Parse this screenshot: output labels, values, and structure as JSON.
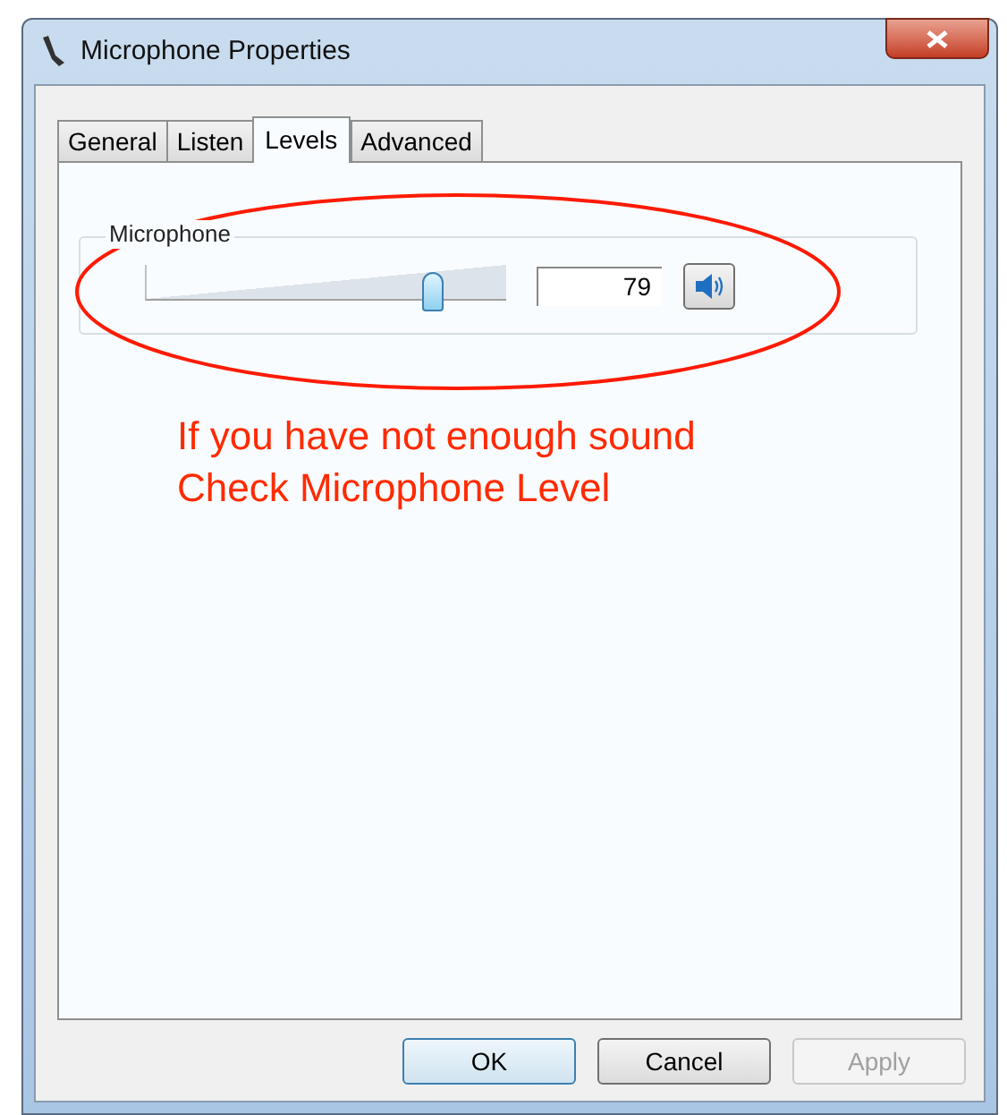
{
  "window": {
    "title": "Microphone Properties"
  },
  "tabs": [
    {
      "label": "General",
      "selected": false
    },
    {
      "label": "Listen",
      "selected": false
    },
    {
      "label": "Levels",
      "selected": true
    },
    {
      "label": "Advanced",
      "selected": false
    }
  ],
  "group": {
    "label": "Microphone",
    "slider": {
      "level": 0.79
    },
    "value": "79"
  },
  "annotation": {
    "lines": [
      "If you have not enough sound",
      "Check Microphone Level"
    ]
  },
  "buttons": [
    {
      "label": "OK",
      "default": true,
      "disabled": false
    },
    {
      "label": "Cancel",
      "default": false,
      "disabled": false
    },
    {
      "label": "Apply",
      "default": false,
      "disabled": true
    }
  ]
}
